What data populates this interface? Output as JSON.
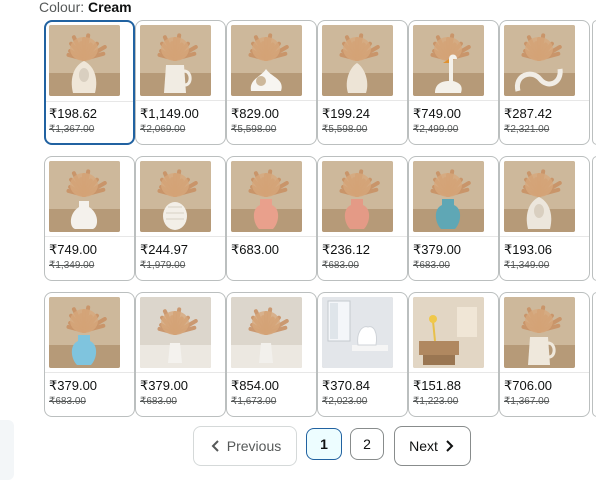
{
  "colour": {
    "label": "Colour:",
    "value": "Cream"
  },
  "swatches": [
    {
      "price": "₹198.62",
      "mrp": "₹1,367.00",
      "vase": "bust",
      "vase_color": "#efe6d8",
      "selected": true
    },
    {
      "price": "₹1,149.00",
      "mrp": "₹2,069.00",
      "vase": "pitcher",
      "vase_color": "#f1ece3",
      "selected": false
    },
    {
      "price": "₹829.00",
      "mrp": "₹5,598.00",
      "vase": "knot",
      "vase_color": "#f7f5f1",
      "selected": false
    },
    {
      "price": "₹199.24",
      "mrp": "₹5,598.00",
      "vase": "bud",
      "vase_color": "#ede4d6",
      "selected": false
    },
    {
      "price": "₹749.00",
      "mrp": "₹2,499.00",
      "vase": "swan",
      "vase_color": "#f4f1ea",
      "selected": false
    },
    {
      "price": "₹287.42",
      "mrp": "₹2,321.00",
      "vase": "loop",
      "vase_color": "#f1ede6",
      "selected": false
    },
    {
      "price": "₹749.00",
      "mrp": "₹1,349.00",
      "vase": "bulb",
      "vase_color": "#f4f1ec",
      "selected": false
    },
    {
      "price": "₹244.97",
      "mrp": "₹1,979.00",
      "vase": "pine",
      "vase_color": "#f3efe8",
      "selected": false
    },
    {
      "price": "₹683.00",
      "mrp": "",
      "vase": "urn",
      "vase_color": "#e9a08c",
      "selected": false
    },
    {
      "price": "₹236.12",
      "mrp": "₹683.00",
      "vase": "urn",
      "vase_color": "#e49a86",
      "selected": false
    },
    {
      "price": "₹379.00",
      "mrp": "₹683.00",
      "vase": "urn",
      "vase_color": "#5fa7b5",
      "selected": false
    },
    {
      "price": "₹193.06",
      "mrp": "₹1,349.00",
      "vase": "bust",
      "vase_color": "#ece6dc",
      "selected": false
    },
    {
      "price": "₹379.00",
      "mrp": "₹683.00",
      "vase": "urn",
      "vase_color": "#7fc4de",
      "selected": false
    },
    {
      "price": "₹379.00",
      "mrp": "₹683.00",
      "vase": "pampas",
      "vase_color": "#f4f2ee",
      "selected": false
    },
    {
      "price": "₹854.00",
      "mrp": "₹1,673.00",
      "vase": "pampas2",
      "vase_color": "#f2f0ec",
      "selected": false
    },
    {
      "price": "₹370.84",
      "mrp": "₹2,023.00",
      "vase": "room",
      "vase_color": "#e8eaee",
      "selected": false
    },
    {
      "price": "₹151.88",
      "mrp": "₹1,223.00",
      "vase": "living",
      "vase_color": "#d8c7ae",
      "selected": false
    },
    {
      "price": "₹706.00",
      "mrp": "₹1,367.00",
      "vase": "pitcher",
      "vase_color": "#efe8dc",
      "selected": false
    }
  ],
  "pagination": {
    "previous": "Previous",
    "pages": [
      "1",
      "2"
    ],
    "current": "1",
    "next": "Next"
  }
}
